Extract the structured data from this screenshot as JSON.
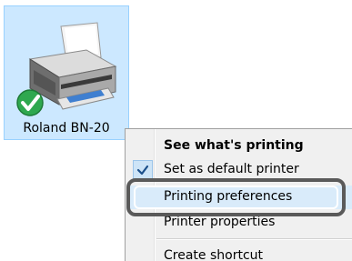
{
  "desktop_icon": {
    "label": "Roland BN-20",
    "icon": "printer-icon",
    "overlay_icon": "default-checkmark-icon"
  },
  "context_menu": {
    "items": [
      {
        "label": "See what's printing",
        "bold": true
      },
      {
        "label": "Set as default printer",
        "checked": true
      },
      {
        "label": "Printing preferences",
        "highlighted": true
      },
      {
        "label": "Printer properties"
      },
      {
        "label": "Create shortcut"
      }
    ]
  },
  "colors": {
    "selection_bg": "#cce8ff",
    "menu_bg": "#f0f0f0",
    "callout_border": "#5a5a5a",
    "check_green": "#2fa84f"
  }
}
